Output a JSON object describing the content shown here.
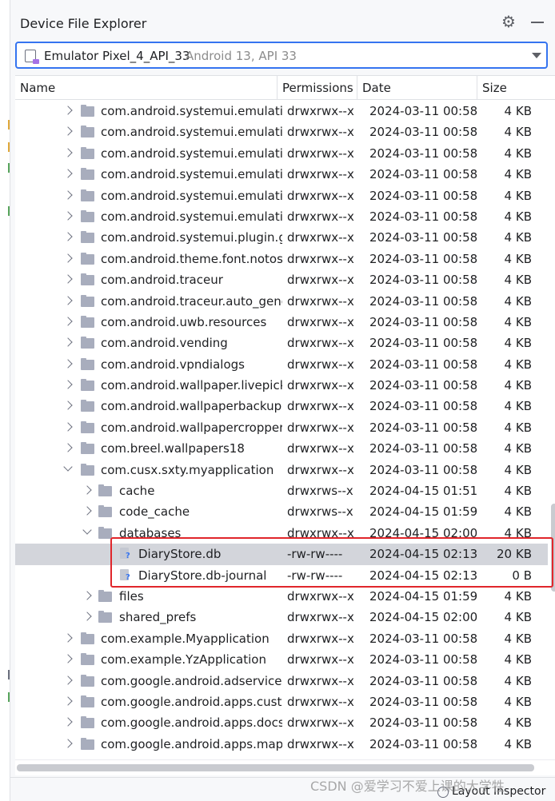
{
  "window": {
    "title": "Device File Explorer"
  },
  "device": {
    "name": "Emulator Pixel_4_API_33",
    "meta": "Android 13, API 33"
  },
  "columns": {
    "name": "Name",
    "permissions": "Permissions",
    "date": "Date",
    "size": "Size"
  },
  "rows": [
    {
      "level": 1,
      "expander": "collapsed",
      "icon": "folder-icon",
      "name": "com.android.systemui.emulatio",
      "perm": "drwxrwx--x",
      "date": "2024-03-11 00:58",
      "size": "4 KB"
    },
    {
      "level": 1,
      "expander": "collapsed",
      "icon": "folder-icon",
      "name": "com.android.systemui.emulatio",
      "perm": "drwxrwx--x",
      "date": "2024-03-11 00:58",
      "size": "4 KB"
    },
    {
      "level": 1,
      "expander": "collapsed",
      "icon": "folder-icon",
      "name": "com.android.systemui.emulatio",
      "perm": "drwxrwx--x",
      "date": "2024-03-11 00:58",
      "size": "4 KB"
    },
    {
      "level": 1,
      "expander": "collapsed",
      "icon": "folder-icon",
      "name": "com.android.systemui.emulatio",
      "perm": "drwxrwx--x",
      "date": "2024-03-11 00:58",
      "size": "4 KB"
    },
    {
      "level": 1,
      "expander": "collapsed",
      "icon": "folder-icon",
      "name": "com.android.systemui.emulatio",
      "perm": "drwxrwx--x",
      "date": "2024-03-11 00:58",
      "size": "4 KB"
    },
    {
      "level": 1,
      "expander": "collapsed",
      "icon": "folder-icon",
      "name": "com.android.systemui.emulatio",
      "perm": "drwxrwx--x",
      "date": "2024-03-11 00:58",
      "size": "4 KB"
    },
    {
      "level": 1,
      "expander": "collapsed",
      "icon": "folder-icon",
      "name": "com.android.systemui.plugin.gl",
      "perm": "drwxrwx--x",
      "date": "2024-03-11 00:58",
      "size": "4 KB"
    },
    {
      "level": 1,
      "expander": "collapsed",
      "icon": "folder-icon",
      "name": "com.android.theme.font.notose",
      "perm": "drwxrwx--x",
      "date": "2024-03-11 00:58",
      "size": "4 KB"
    },
    {
      "level": 1,
      "expander": "collapsed",
      "icon": "folder-icon",
      "name": "com.android.traceur",
      "perm": "drwxrwx--x",
      "date": "2024-03-11 00:58",
      "size": "4 KB"
    },
    {
      "level": 1,
      "expander": "collapsed",
      "icon": "folder-icon",
      "name": "com.android.traceur.auto_gene",
      "perm": "drwxrwx--x",
      "date": "2024-03-11 00:58",
      "size": "4 KB"
    },
    {
      "level": 1,
      "expander": "collapsed",
      "icon": "folder-icon",
      "name": "com.android.uwb.resources",
      "perm": "drwxrwx--x",
      "date": "2024-03-11 00:58",
      "size": "4 KB"
    },
    {
      "level": 1,
      "expander": "collapsed",
      "icon": "folder-icon",
      "name": "com.android.vending",
      "perm": "drwxrwx--x",
      "date": "2024-03-11 00:58",
      "size": "4 KB"
    },
    {
      "level": 1,
      "expander": "collapsed",
      "icon": "folder-icon",
      "name": "com.android.vpndialogs",
      "perm": "drwxrwx--x",
      "date": "2024-03-11 00:58",
      "size": "4 KB"
    },
    {
      "level": 1,
      "expander": "collapsed",
      "icon": "folder-icon",
      "name": "com.android.wallpaper.livepick",
      "perm": "drwxrwx--x",
      "date": "2024-03-11 00:58",
      "size": "4 KB"
    },
    {
      "level": 1,
      "expander": "collapsed",
      "icon": "folder-icon",
      "name": "com.android.wallpaperbackup",
      "perm": "drwxrwx--x",
      "date": "2024-03-11 00:58",
      "size": "4 KB"
    },
    {
      "level": 1,
      "expander": "collapsed",
      "icon": "folder-icon",
      "name": "com.android.wallpapercropper",
      "perm": "drwxrwx--x",
      "date": "2024-03-11 00:58",
      "size": "4 KB"
    },
    {
      "level": 1,
      "expander": "collapsed",
      "icon": "folder-icon",
      "name": "com.breel.wallpapers18",
      "perm": "drwxrwx--x",
      "date": "2024-03-11 00:58",
      "size": "4 KB"
    },
    {
      "level": 1,
      "expander": "expanded",
      "icon": "folder-icon",
      "name": "com.cusx.sxty.myapplication",
      "perm": "drwxrwx--x",
      "date": "2024-03-11 00:58",
      "size": "4 KB"
    },
    {
      "level": 2,
      "expander": "collapsed",
      "icon": "folder-icon",
      "name": "cache",
      "perm": "drwxrws--x",
      "date": "2024-04-15 01:51",
      "size": "4 KB"
    },
    {
      "level": 2,
      "expander": "collapsed",
      "icon": "folder-icon",
      "name": "code_cache",
      "perm": "drwxrws--x",
      "date": "2024-04-15 01:59",
      "size": "4 KB"
    },
    {
      "level": 2,
      "expander": "expanded",
      "icon": "folder-icon",
      "name": "databases",
      "perm": "drwxrwx--x",
      "date": "2024-04-15 02:00",
      "size": "4 KB"
    },
    {
      "level": 3,
      "expander": "none",
      "icon": "database-file-icon",
      "name": "DiaryStore.db",
      "perm": "-rw-rw----",
      "date": "2024-04-15 02:13",
      "size": "20 KB",
      "selected": true
    },
    {
      "level": 3,
      "expander": "none",
      "icon": "database-file-icon",
      "name": "DiaryStore.db-journal",
      "perm": "-rw-rw----",
      "date": "2024-04-15 02:13",
      "size": "0 B"
    },
    {
      "level": 2,
      "expander": "collapsed",
      "icon": "folder-icon",
      "name": "files",
      "perm": "drwxrwx--x",
      "date": "2024-04-15 01:59",
      "size": "4 KB"
    },
    {
      "level": 2,
      "expander": "collapsed",
      "icon": "folder-icon",
      "name": "shared_prefs",
      "perm": "drwxrwx--x",
      "date": "2024-04-15 02:00",
      "size": "4 KB"
    },
    {
      "level": 1,
      "expander": "collapsed",
      "icon": "folder-icon",
      "name": "com.example.Myapplication",
      "perm": "drwxrwx--x",
      "date": "2024-03-11 00:58",
      "size": "4 KB"
    },
    {
      "level": 1,
      "expander": "collapsed",
      "icon": "folder-icon",
      "name": "com.example.YzApplication",
      "perm": "drwxrwx--x",
      "date": "2024-03-11 00:58",
      "size": "4 KB"
    },
    {
      "level": 1,
      "expander": "collapsed",
      "icon": "folder-icon",
      "name": "com.google.android.adservices.",
      "perm": "drwxrwx--x",
      "date": "2024-03-11 00:58",
      "size": "4 KB"
    },
    {
      "level": 1,
      "expander": "collapsed",
      "icon": "folder-icon",
      "name": "com.google.android.apps.custo",
      "perm": "drwxrwx--x",
      "date": "2024-03-11 00:58",
      "size": "4 KB"
    },
    {
      "level": 1,
      "expander": "collapsed",
      "icon": "folder-icon",
      "name": "com.google.android.apps.docs",
      "perm": "drwxrwx--x",
      "date": "2024-03-11 00:58",
      "size": "4 KB"
    },
    {
      "level": 1,
      "expander": "collapsed",
      "icon": "folder-icon",
      "name": "com.google.android.apps.maps",
      "perm": "drwxrwx--x",
      "date": "2024-03-11 00:58",
      "size": "4 KB"
    }
  ],
  "statusbar": {
    "layout_inspector": "Layout Inspector"
  },
  "watermark": "CSDN @爱学习不爱上课的大学牲",
  "colors": {
    "accent": "#3574f0",
    "selection": "#d3d5db",
    "annotation_box": "#e0262b"
  }
}
